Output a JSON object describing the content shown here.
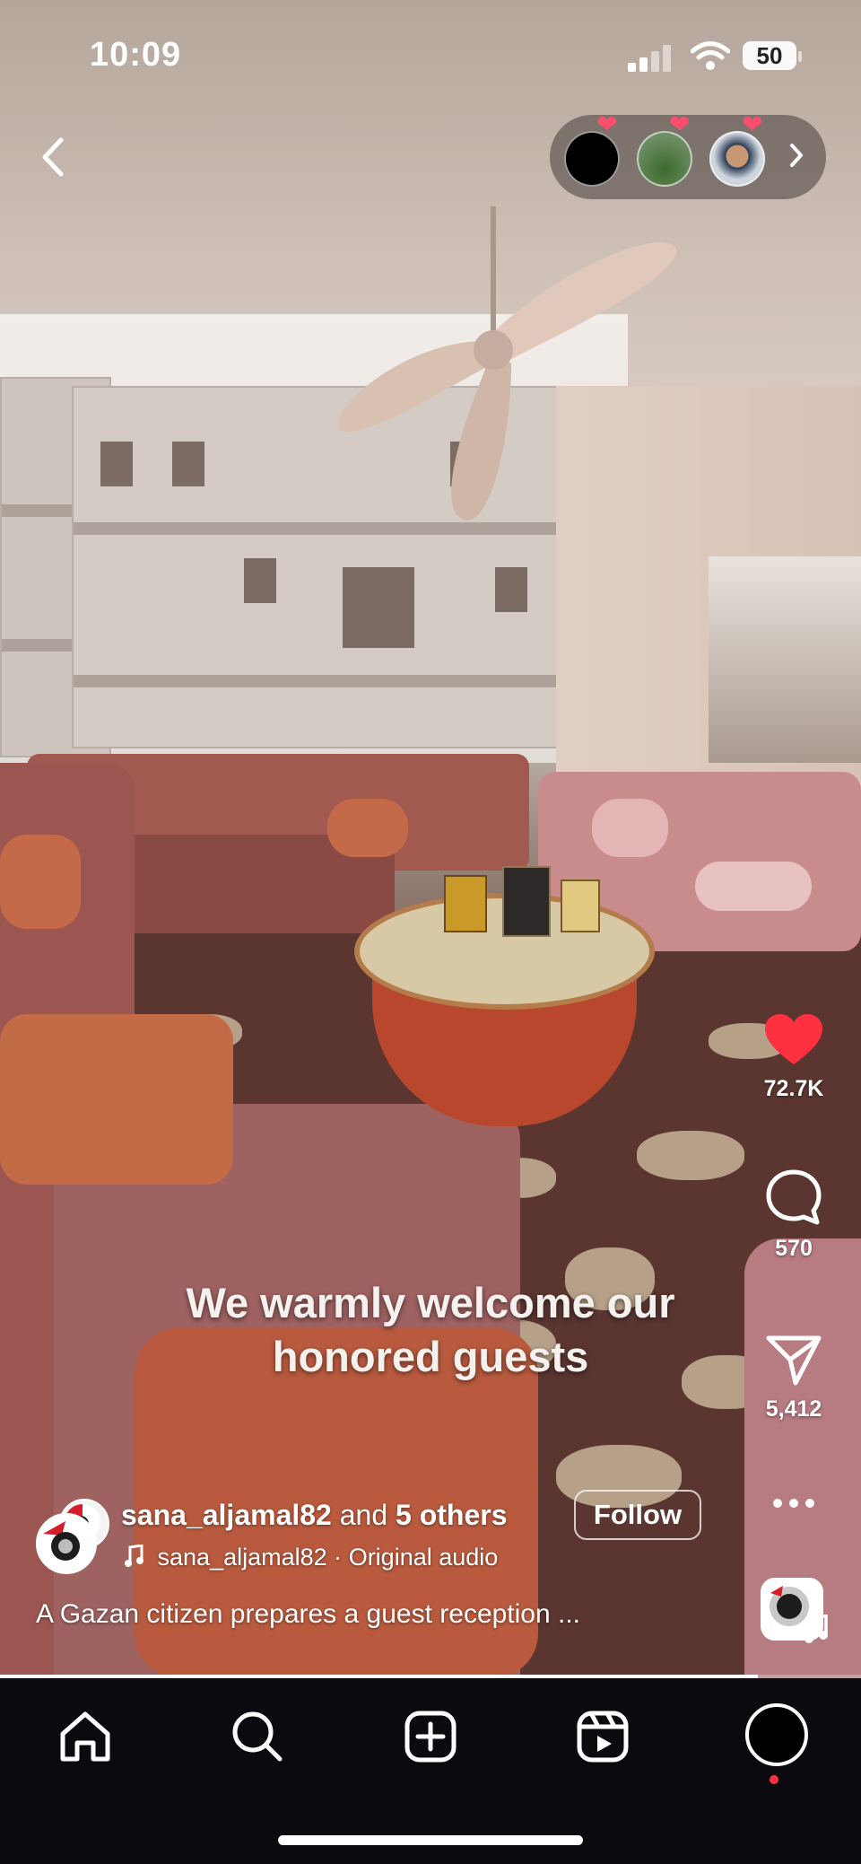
{
  "status_bar": {
    "time": "10:09",
    "battery": "50",
    "icons": [
      "signal-icon",
      "wifi-icon",
      "battery-icon"
    ]
  },
  "top": {
    "back_icon": "chevron-left-icon",
    "viewers_icon": "chevron-right-icon"
  },
  "video": {
    "caption_line1": "We warmly welcome our",
    "caption_line2": "honored guests"
  },
  "actions": {
    "likes": "72.7K",
    "comments": "570",
    "shares": "5,412",
    "like_color": "#ff3040",
    "more_icon": "more-horizontal-icon"
  },
  "author": {
    "username": "sana_aljamal82",
    "collab_text": "and",
    "others": "5 others",
    "follow_label": "Follow",
    "audio_user": "sana_aljamal82",
    "audio_sep": "·",
    "audio_label": "Original audio",
    "description": "A Gazan citizen prepares a guest reception ..."
  },
  "playback": {
    "progress": 0.88
  },
  "nav": {
    "items": [
      "home-icon",
      "search-icon",
      "create-icon",
      "reels-icon",
      "profile-icon"
    ],
    "notification_color": "#ff3040"
  }
}
